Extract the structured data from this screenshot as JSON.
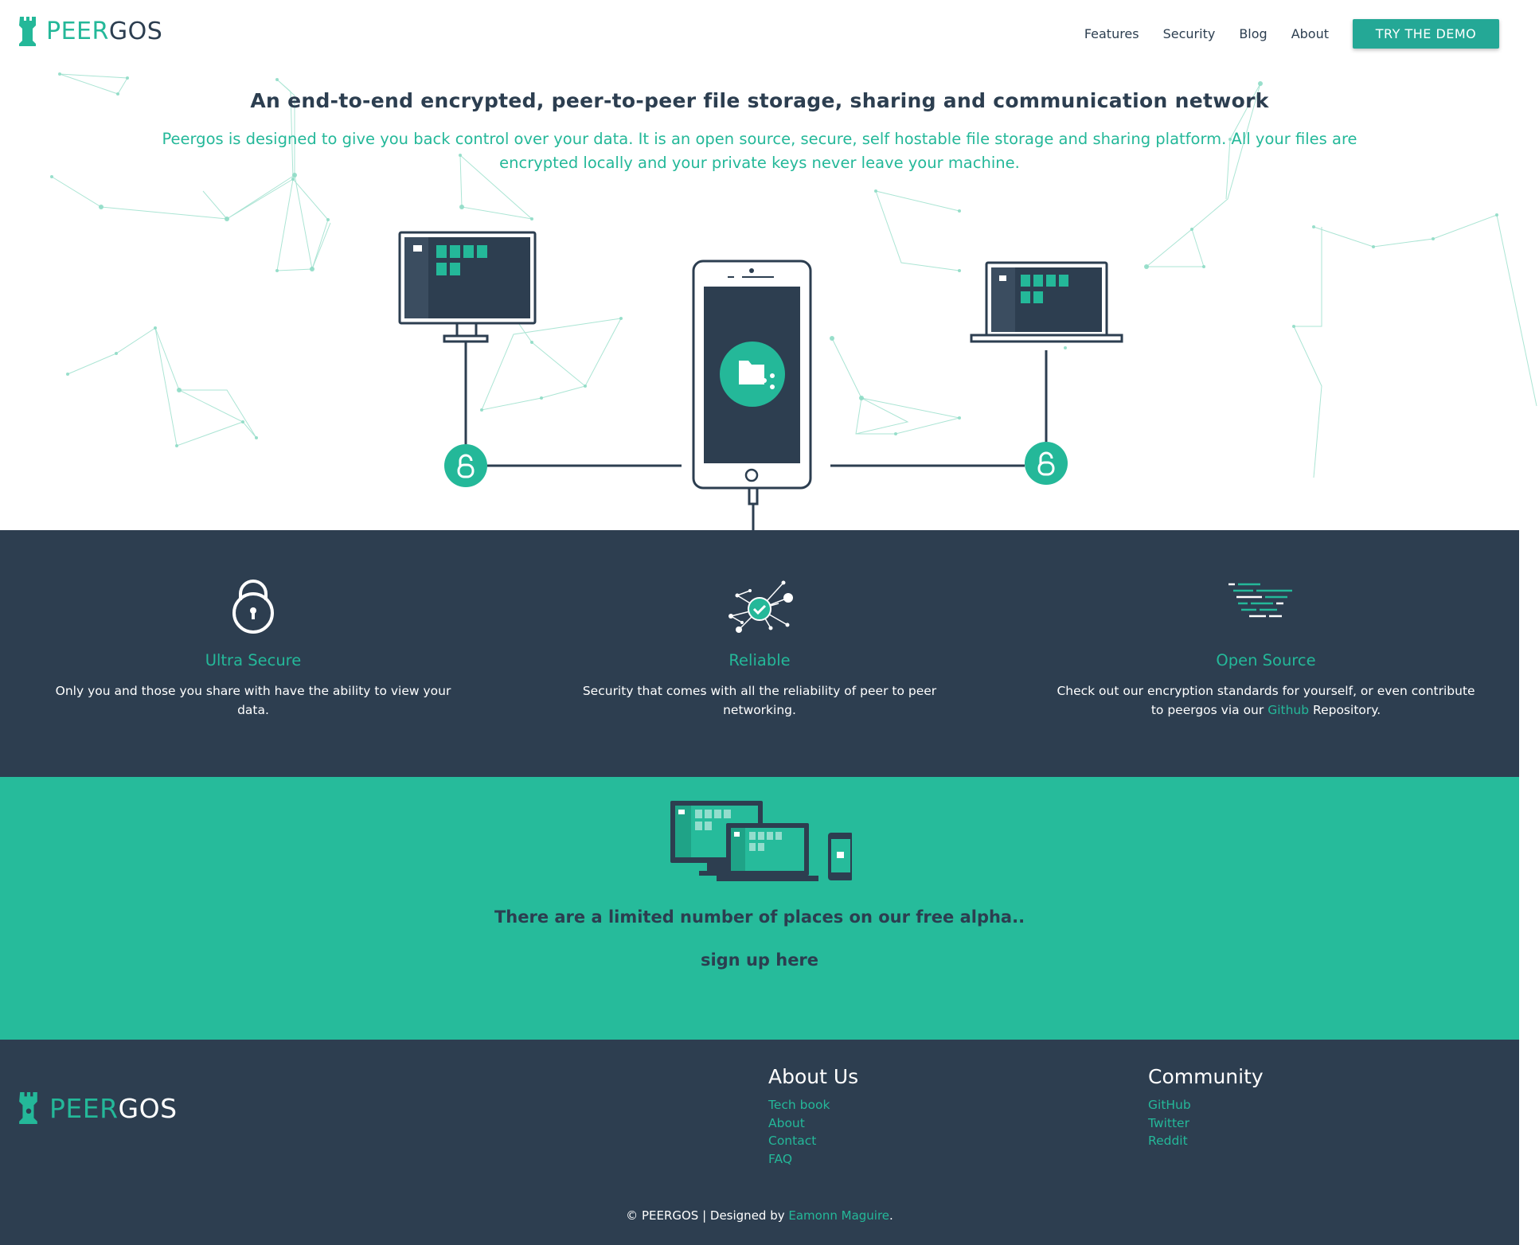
{
  "header": {
    "brand_part1": "PEER",
    "brand_part2": "GOS",
    "nav": [
      {
        "label": "Features"
      },
      {
        "label": "Security"
      },
      {
        "label": "Blog"
      },
      {
        "label": "About"
      }
    ],
    "demo_button": "TRY THE DEMO"
  },
  "hero": {
    "title": "An end-to-end encrypted, peer-to-peer file storage, sharing and communication network",
    "subtitle": "Peergos is designed to give you back control over your data. It is an open source, secure, self hostable file storage and sharing platform. All your files are encrypted locally and your private keys never leave your machine."
  },
  "features": [
    {
      "icon": "padlock-icon",
      "title": "Ultra Secure",
      "description": "Only you and those you share with have the ability to view your data."
    },
    {
      "icon": "network-check-icon",
      "title": "Reliable",
      "description": "Security that comes with all the reliability of peer to peer networking."
    },
    {
      "icon": "code-lines-icon",
      "title": "Open Source",
      "description_before": "Check out our encryption standards for yourself, or even contribute to peergos via our ",
      "link": "Github",
      "description_after": " Repository."
    }
  ],
  "signup": {
    "text": "There are a limited number of places on our free alpha..",
    "link": "sign up here"
  },
  "footer": {
    "brand_part1": "PEER",
    "brand_part2": "GOS",
    "about": {
      "title": "About Us",
      "links": [
        "Tech book",
        "About",
        "Contact",
        "FAQ"
      ]
    },
    "community": {
      "title": "Community",
      "links": [
        "GitHub",
        "Twitter",
        "Reddit"
      ]
    },
    "copyright_prefix": "© PEERGOS | Designed by ",
    "designer": "Eamonn Maguire",
    "copyright_suffix": "."
  },
  "colors": {
    "accent": "#24b899",
    "dark": "#2d3e50",
    "signup_bg": "#26bb9b",
    "button": "#24a896"
  }
}
